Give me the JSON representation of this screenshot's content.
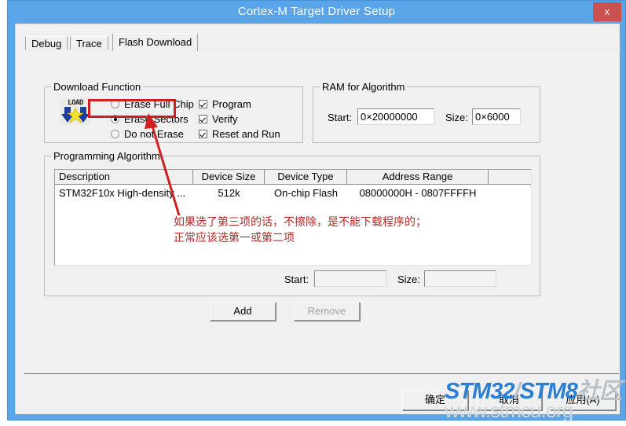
{
  "window": {
    "title": "Cortex-M Target Driver Setup",
    "close_label": "x",
    "titlebar_color": "#5aa5e8",
    "close_color": "#cb5050"
  },
  "tabs": [
    {
      "label": "Debug",
      "active": false
    },
    {
      "label": "Trace",
      "active": false
    },
    {
      "label": "Flash Download",
      "active": true
    }
  ],
  "download_function": {
    "title": "Download Function",
    "icon_label": "LOAD",
    "radios": [
      {
        "label": "Erase Full Chip",
        "checked": false
      },
      {
        "label": "Erase Sectors",
        "checked": true
      },
      {
        "label": "Do not Erase",
        "checked": false
      }
    ],
    "checkboxes": [
      {
        "label": "Program",
        "checked": true
      },
      {
        "label": "Verify",
        "checked": true
      },
      {
        "label": "Reset and Run",
        "checked": true
      }
    ]
  },
  "ram_for_algorithm": {
    "title": "RAM for Algorithm",
    "start_label": "Start:",
    "start_value": "0×20000000",
    "size_label": "Size:",
    "size_value": "0×6000"
  },
  "programming_algorithm": {
    "title": "Programming Algorithm",
    "columns": [
      "Description",
      "Device Size",
      "Device Type",
      "Address Range",
      ""
    ],
    "rows": [
      {
        "description": "STM32F10x High-density ...",
        "device_size": "512k",
        "device_type": "On-chip Flash",
        "address_range": "08000000H - 0807FFFFH"
      }
    ],
    "start_label": "Start:",
    "start_value": "",
    "size_label": "Size:",
    "size_value": ""
  },
  "list_buttons": {
    "add_label": "Add",
    "remove_label": "Remove"
  },
  "dialog_buttons": {
    "ok_label": "确定",
    "cancel_label": "取消",
    "apply_label": "应用(A)"
  },
  "annotations": {
    "text_line1": "如果选了第三项的话，不擦除，是不能下载程序的；",
    "text_line2": "正常应该选第一或第二项",
    "color": "#b52828",
    "box_color": "#cf1f1f"
  },
  "watermark": {
    "line1_a": "STM32",
    "line1_b": "/",
    "line1_c": "STM8",
    "line1_d": "社区",
    "line2": "www.stmcu.org",
    "blue": "#2a7fd4",
    "gray": "#b9c2c9"
  }
}
